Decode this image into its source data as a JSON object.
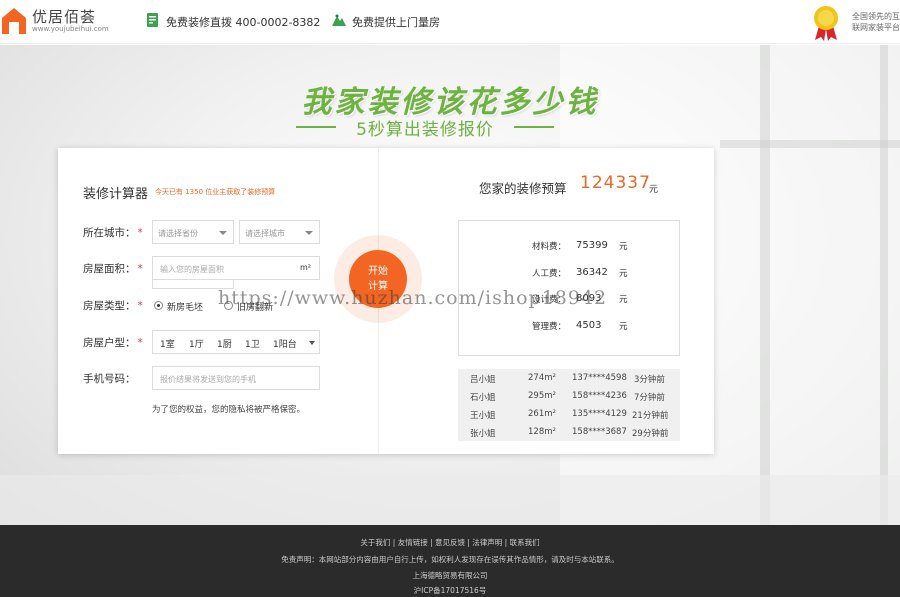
{
  "header": {
    "brand_name": "优居佰荟",
    "brand_url": "www.youjubeihui.com",
    "hotline_text": "免费装修直拨 400-0002-8382",
    "survey_text": "免费提供上门量房",
    "slogan_line1": "全国领先的互",
    "slogan_line2": "联网家装平台"
  },
  "hero": {
    "title": "我家装修该花多少钱",
    "subtitle": "5秒算出装修报价"
  },
  "calculator": {
    "title": "装修计算器",
    "note": "今天已有 1350 位业主获取了装修预算",
    "city_label": "所在城市：",
    "province_placeholder": "请选择省份",
    "city_placeholder": "请选择城市",
    "area_label": "房屋面积：",
    "area_placeholder": "输入您的房屋面积",
    "area_unit": "m²",
    "type_label": "房屋类型：",
    "type_options": [
      "新房毛坯",
      "旧房翻新"
    ],
    "layout_label": "房屋户型：",
    "layout_values": [
      "1室",
      "1厅",
      "1厨",
      "1卫",
      "1阳台"
    ],
    "phone_label": "手机号码：",
    "phone_placeholder": "报价结果将发送到您的手机",
    "privacy": "为了您的权益，您的隐私将被严格保密。",
    "required_mark": "*",
    "start_line1": "开始",
    "start_line2": "计算"
  },
  "result": {
    "heading": "您家的装修预算",
    "total": "124337",
    "unit": "元",
    "costs": [
      {
        "label": "材料费：",
        "value": "75399",
        "unit": "元"
      },
      {
        "label": "人工费：",
        "value": "36342",
        "unit": "元"
      },
      {
        "label": "设计费：",
        "value": "8093",
        "unit": "元"
      },
      {
        "label": "管理费：",
        "value": "4503",
        "unit": "元"
      }
    ],
    "recent": [
      {
        "name": "吕小姐",
        "area": "274m²",
        "phone": "137****4598",
        "time": "3分钟前"
      },
      {
        "name": "石小姐",
        "area": "295m²",
        "phone": "158****4236",
        "time": "7分钟前"
      },
      {
        "name": "王小姐",
        "area": "261m²",
        "phone": "135****4129",
        "time": "21分钟前"
      },
      {
        "name": "张小姐",
        "area": "128m²",
        "phone": "158****3687",
        "time": "29分钟前"
      }
    ]
  },
  "footer": {
    "links": "关于我们 | 友情链接 | 意见反馈 | 法律声明 | 联系我们",
    "disclaimer": "免责声明：本网站部分内容由用户自行上传，如权利人发现存在误传其作品情形，请及时与本站联系。",
    "company": "上海德略贸易有限公司",
    "icp": "沪ICP备17017516号"
  },
  "watermark": "https://www.huzhan.com/ishop18942",
  "colors": {
    "brand_green": "#6db33f",
    "accent_orange": "#f26522",
    "required_red": "#e4393c",
    "footer_bg": "#2b2b2b"
  }
}
